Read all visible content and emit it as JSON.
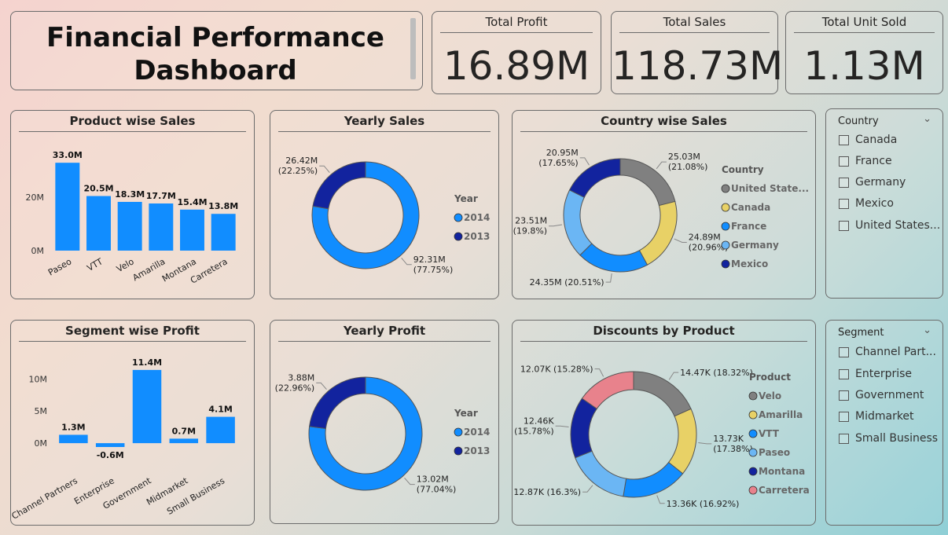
{
  "header": {
    "title_line1": "Financial Performance",
    "title_line2": "Dashboard"
  },
  "kpis": [
    {
      "label": "Total Profit",
      "value": "16.89M"
    },
    {
      "label": "Total Sales",
      "value": "118.73M"
    },
    {
      "label": "Total Unit Sold",
      "value": "1.13M"
    }
  ],
  "slicers": {
    "country": {
      "title": "Country",
      "items": [
        "Canada",
        "France",
        "Germany",
        "Mexico",
        "United States..."
      ]
    },
    "segment": {
      "title": "Segment",
      "items": [
        "Channel Part...",
        "Enterprise",
        "Government",
        "Midmarket",
        "Small Business"
      ]
    }
  },
  "chart_data": [
    {
      "type": "bar",
      "title": "Product wise Sales",
      "categories": [
        "Paseo",
        "VTT",
        "Velo",
        "Amarilla",
        "Montana",
        "Carretera"
      ],
      "values": [
        33.0,
        20.5,
        18.3,
        17.7,
        15.4,
        13.8
      ],
      "value_labels": [
        "33.0M",
        "20.5M",
        "18.3M",
        "17.7M",
        "15.4M",
        "13.8M"
      ],
      "yticks": [
        "0M",
        "20M"
      ],
      "ylim": [
        0,
        36
      ],
      "color": "#118dff"
    },
    {
      "type": "pie",
      "donut": true,
      "title": "Yearly Sales",
      "legend_title": "Year",
      "slices": [
        {
          "name": "2014",
          "value": 92.31,
          "label": "92.31M",
          "pct": "(77.75%)",
          "color": "#118dff"
        },
        {
          "name": "2013",
          "value": 26.42,
          "label": "26.42M",
          "pct": "(22.25%)",
          "color": "#12239e"
        }
      ]
    },
    {
      "type": "pie",
      "donut": true,
      "title": "Country wise Sales",
      "legend_title": "Country",
      "slices": [
        {
          "name": "United State...",
          "value": 25.03,
          "label": "25.03M",
          "pct": "(21.08%)",
          "color": "#808080"
        },
        {
          "name": "Canada",
          "value": 24.89,
          "label": "24.89M",
          "pct": "(20.96%)",
          "color": "#e8d166"
        },
        {
          "name": "France",
          "value": 24.35,
          "label": "24.35M (20.51%)",
          "pct": "",
          "color": "#118dff"
        },
        {
          "name": "Germany",
          "value": 23.51,
          "label": "23.51M",
          "pct": "(19.8%)",
          "color": "#6bb6f4"
        },
        {
          "name": "Mexico",
          "value": 20.95,
          "label": "20.95M",
          "pct": "(17.65%)",
          "color": "#12239e"
        }
      ]
    },
    {
      "type": "bar",
      "title": "Segment wise Profit",
      "categories": [
        "Channel Partners",
        "Enterprise",
        "Government",
        "Midmarket",
        "Small Business"
      ],
      "values": [
        1.3,
        -0.6,
        11.4,
        0.7,
        4.1
      ],
      "value_labels": [
        "1.3M",
        "-0.6M",
        "11.4M",
        "0.7M",
        "4.1M"
      ],
      "yticks": [
        "0M",
        "5M",
        "10M"
      ],
      "ylim": [
        -0.6,
        12
      ],
      "color": "#118dff"
    },
    {
      "type": "pie",
      "donut": true,
      "title": "Yearly Profit",
      "legend_title": "Year",
      "slices": [
        {
          "name": "2014",
          "value": 13.02,
          "label": "13.02M",
          "pct": "(77.04%)",
          "color": "#118dff"
        },
        {
          "name": "2013",
          "value": 3.88,
          "label": "3.88M",
          "pct": "(22.96%)",
          "color": "#12239e"
        }
      ]
    },
    {
      "type": "pie",
      "donut": true,
      "title": "Discounts by Product",
      "legend_title": "Product",
      "slices": [
        {
          "name": "Velo",
          "value": 14.47,
          "label": "14.47K (18.32%)",
          "pct": "",
          "color": "#808080"
        },
        {
          "name": "Amarilla",
          "value": 13.73,
          "label": "13.73K",
          "pct": "(17.38%)",
          "color": "#e8d166"
        },
        {
          "name": "VTT",
          "value": 13.36,
          "label": "13.36K (16.92%)",
          "pct": "",
          "color": "#118dff"
        },
        {
          "name": "Paseo",
          "value": 12.87,
          "label": "12.87K (16.3%)",
          "pct": "",
          "color": "#6bb6f4"
        },
        {
          "name": "Montana",
          "value": 12.46,
          "label": "12.46K",
          "pct": "(15.78%)",
          "color": "#12239e"
        },
        {
          "name": "Carretera",
          "value": 12.07,
          "label": "12.07K (15.28%)",
          "pct": "",
          "color": "#e8828c"
        }
      ]
    }
  ]
}
